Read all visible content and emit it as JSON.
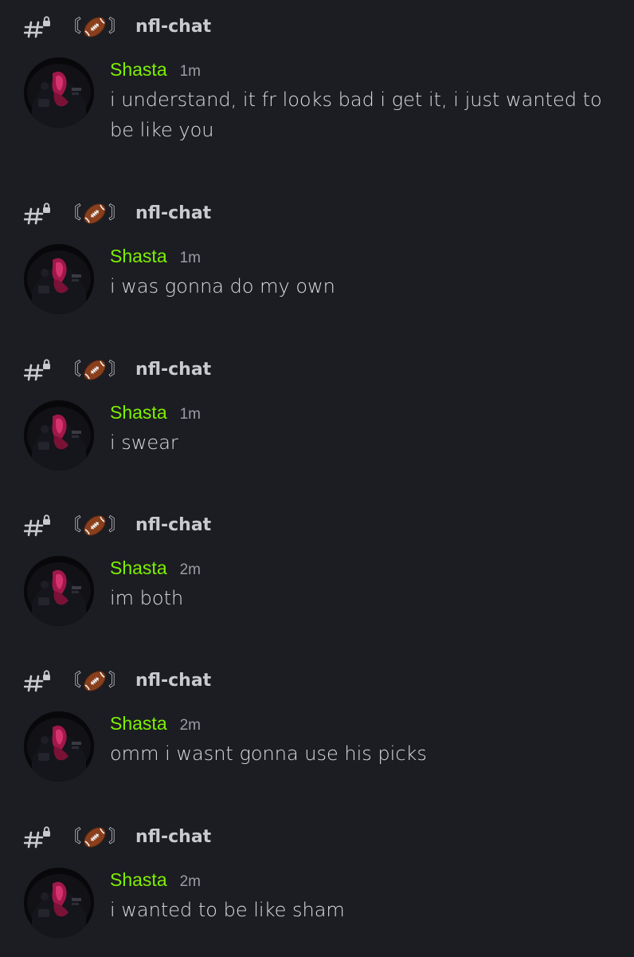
{
  "channel": {
    "prefix_icon": "hash-lock-icon",
    "emoji_icon": "football-icon",
    "bracket_open": "〘",
    "bracket_close": "〙",
    "name": "nfl-chat"
  },
  "colors": {
    "background": "#1c1d22",
    "username": "#7ef000",
    "timestamp": "#9b9ca3",
    "message_text": "#dcdde1",
    "channel_text": "#c9cace"
  },
  "messages": [
    {
      "channel": "nfl-chat",
      "author": "Shasta",
      "time": "1m",
      "text": "i understand, it fr looks bad i get it, i just wanted to be like you"
    },
    {
      "channel": "nfl-chat",
      "author": "Shasta",
      "time": "1m",
      "text": "i was gonna do my own"
    },
    {
      "channel": "nfl-chat",
      "author": "Shasta",
      "time": "1m",
      "text": "i swear"
    },
    {
      "channel": "nfl-chat",
      "author": "Shasta",
      "time": "2m",
      "text": "im both"
    },
    {
      "channel": "nfl-chat",
      "author": "Shasta",
      "time": "2m",
      "text": "omm i wasnt gonna use his picks"
    },
    {
      "channel": "nfl-chat",
      "author": "Shasta",
      "time": "2m",
      "text": "i wanted to be like sham"
    }
  ]
}
